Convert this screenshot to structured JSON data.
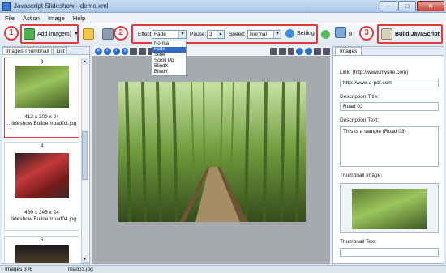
{
  "window": {
    "title": "Javascript Slideshow - demo.xml"
  },
  "menu": [
    "File",
    "Action",
    "Image",
    "Help"
  ],
  "toolbar": {
    "add_images": "Add Image(s)",
    "effect_label": "Effect:",
    "effect_value": "Fade",
    "effect_options": [
      "Normal",
      "Fade",
      "Slide",
      "Scroll Up",
      "BlindX",
      "BlindY"
    ],
    "pause_label": "Pause:",
    "pause_value": "3",
    "speed_label": "Speed:",
    "speed_value": "Normal",
    "setting_label": "Setting",
    "build_label": "Build JavaScript",
    "b_label": "B"
  },
  "annotations": {
    "n1": "1",
    "n2": "2",
    "n3": "3"
  },
  "left_panel": {
    "tabs": [
      "Images Thumbnail",
      "List"
    ],
    "thumbnails": [
      {
        "number": "3",
        "size": "412 x 309 x 24",
        "path": "...lideshow Builder\\road03.jpg"
      },
      {
        "number": "4",
        "size": "460 x 345 x 24",
        "path": "...lideshow Builder\\road04.jpg"
      },
      {
        "number": "5"
      }
    ]
  },
  "right_panel": {
    "tab": "Images",
    "link_label": "Link: (http://www.mysite.com)",
    "link_value": "http://www.a-pdf.com",
    "desc_title_label": "Description Title:",
    "desc_title_value": "Road 03",
    "desc_text_label": "Description Text:",
    "desc_text_value": "This is a sample (Road 03)",
    "thumb_image_label": "Thumbnail Image:",
    "thumb_text_label": "Thumbnail Text:"
  },
  "status": {
    "count": "Images 3 /6",
    "file": "road03.jpg"
  }
}
